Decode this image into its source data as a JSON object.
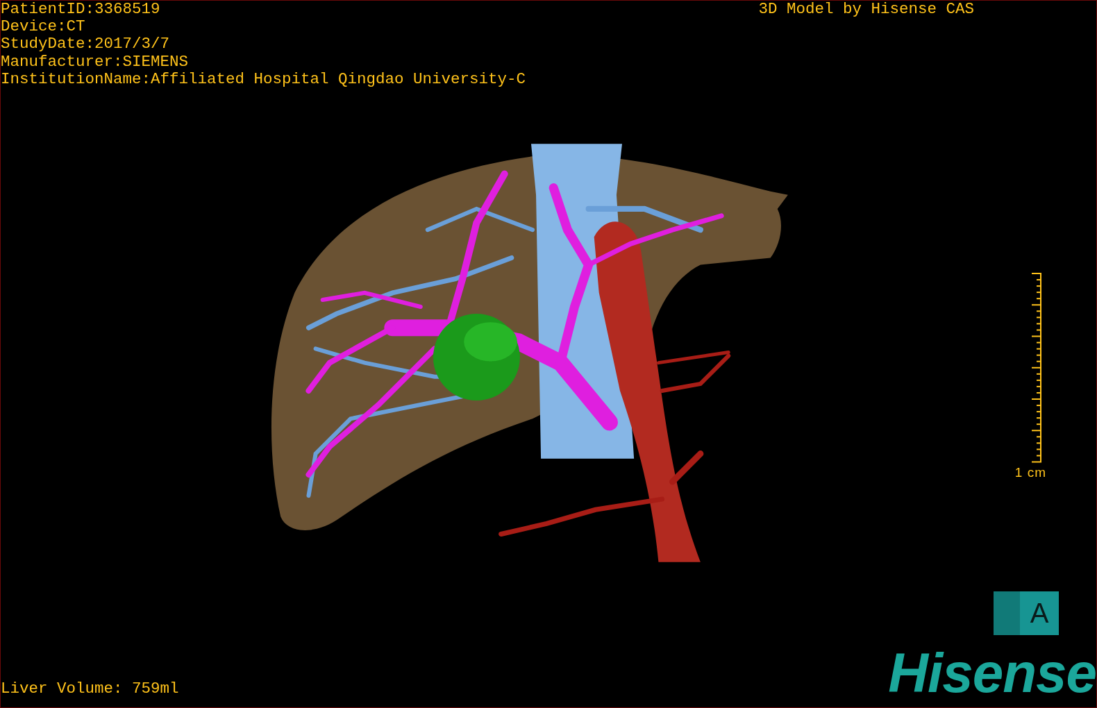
{
  "viewer": {
    "info_lines": [
      "PatientID:3368519",
      "Device:CT",
      "StudyDate:2017/3/7",
      "Manufacturer:SIEMENS",
      "InstitutionName:Affiliated Hospital Qingdao University-C"
    ],
    "title": "3D Model by Hisense CAS",
    "scale_bar": {
      "label": "1 cm"
    },
    "volume": "Liver Volume: 759ml",
    "orientation_cube": {
      "front_label": "A"
    },
    "logo": "Hisense"
  }
}
